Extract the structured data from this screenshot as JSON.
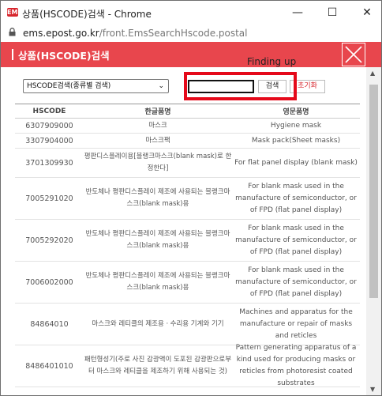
{
  "window": {
    "title": "상품(HSCODE)검색 - Chrome",
    "app_icon": "EMS",
    "controls": {
      "minimize": "—",
      "maximize": "☐",
      "close": "✕"
    }
  },
  "address_bar": {
    "host": "ems.epost.go.kr",
    "path": "/front.EmsSearchHscode.postal"
  },
  "header": {
    "title": "상품(HSCODE)검색"
  },
  "annotation": {
    "text": "Finding up",
    "highlight_color": "#e5091a"
  },
  "search": {
    "select_value": "HSCODE검색(종류별 검색)",
    "input_value": "",
    "search_label": "검색",
    "reset_label": "초기화"
  },
  "table": {
    "headers": [
      "HSCODE",
      "한글품명",
      "영문품명"
    ],
    "rows": [
      {
        "code": "6307909000",
        "kr": "마스크",
        "en": "Hygiene mask"
      },
      {
        "code": "3307904000",
        "kr": "마스크팩",
        "en": "Mask pack(Sheet masks)"
      },
      {
        "code": "3701309930",
        "kr": "평판디스플레이용[블랭크마스크(blank mask)로 한정한다]",
        "en": "For flat panel display (blank mask)"
      },
      {
        "code": "7005291020",
        "kr": "반도체나 평판디스플레이 제조에 사용되는 블랭크마스크(blank mask)용",
        "en": "For blank mask used in the manufacture of semiconductor, or of FPD (flat panel display)"
      },
      {
        "code": "7005292020",
        "kr": "반도체나 평판디스플레이 제조에 사용되는 블랭크마스크(blank mask)용",
        "en": "For blank mask used in the manufacture of semiconductor, or of FPD (flat panel display)"
      },
      {
        "code": "7006002000",
        "kr": "반도체나 평판디스플레이 제조에 사용되는 블랭크마스크(blank mask)용",
        "en": "For blank mask used in the manufacture of semiconductor, or of FPD (flat panel display)"
      },
      {
        "code": "84864010",
        "kr": "마스크와 레티클의 제조용ㆍ수리용 기계와 기기",
        "en": "Machines and apparatus for the manufacture or repair of masks and reticles"
      },
      {
        "code": "8486401010",
        "kr": "패턴형성기(주로 사진 감광액이 도포된 감광판으로부터 마스크와 레티클을 제조하기 위해 사용되는 것)",
        "en": "Pattern generating apparatus of a kind used for producing masks or reticles from photoresist coated substrates"
      }
    ]
  },
  "icons": [
    "lock-icon",
    "chevron-down-icon",
    "close-icon",
    "scroll-up-icon",
    "scroll-down-icon"
  ]
}
